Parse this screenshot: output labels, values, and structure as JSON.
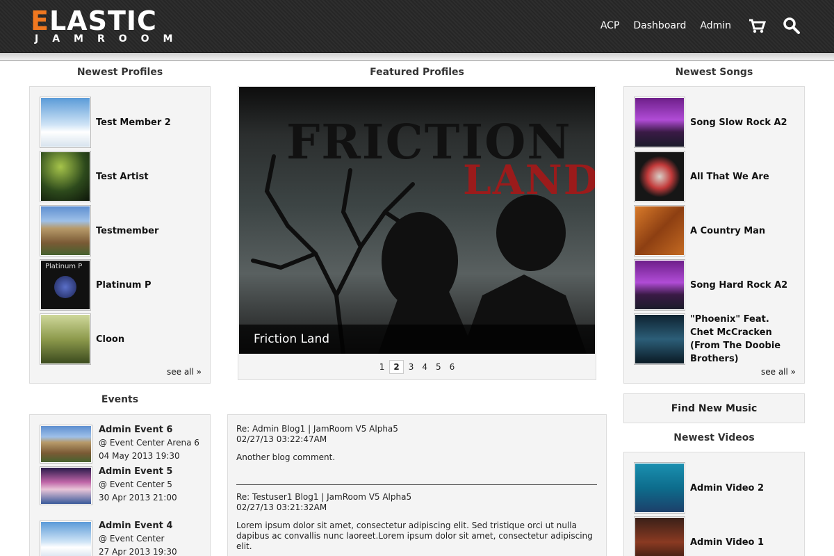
{
  "header": {
    "logo_main_accent": "E",
    "logo_main_rest": "LASTIC",
    "logo_sub": "JAMROOM",
    "nav": [
      "ACP",
      "Dashboard",
      "Admin"
    ],
    "icons": [
      "cart-icon",
      "search-icon"
    ]
  },
  "newest_profiles": {
    "title": "Newest Profiles",
    "items": [
      "Test Member 2",
      "Test Artist",
      "Testmember",
      "Platinum P",
      "Cloon"
    ],
    "see_all": "see all »",
    "platinum_thumb_text": "Platinum P"
  },
  "featured": {
    "title": "Featured Profiles",
    "image_text_1": "FRICTION",
    "image_text_2": "LAND",
    "caption": "Friction Land",
    "pages": [
      "1",
      "2",
      "3",
      "4",
      "5",
      "6"
    ],
    "active_page": "2"
  },
  "newest_songs": {
    "title": "Newest Songs",
    "items": [
      "Song Slow Rock A2",
      "All That We Are",
      "A Country Man",
      "Song Hard Rock A2",
      "\"Phoenix\" Feat. Chet McCracken (From The Doobie Brothers)"
    ],
    "see_all": "see all »"
  },
  "events": {
    "title": "Events",
    "items": [
      {
        "title": "Admin Event 6",
        "venue": "@ Event Center Arena 6",
        "date": "04 May 2013 19:30"
      },
      {
        "title": "Admin Event 5",
        "venue": "@ Event Center 5",
        "date": "30 Apr 2013 21:00"
      },
      {
        "title": "Admin Event 4",
        "venue": "@ Event Center",
        "date": "27 Apr 2013 19:30"
      }
    ]
  },
  "blog": {
    "entries": [
      {
        "title": "Re: Admin Blog1 | JamRoom V5 Alpha5",
        "date": "02/27/13 03:22:47AM",
        "body": "Another blog comment."
      },
      {
        "title": "Re: Testuser1 Blog1 | JamRoom V5 Alpha5",
        "date": "02/27/13 03:21:32AM",
        "body": "Lorem ipsum dolor sit amet, consectetur adipiscing elit. Sed tristique orci ut nulla dapibus ac convallis nunc laoreet.Lorem ipsum dolor sit amet, consectetur adipiscing elit."
      }
    ]
  },
  "find_music": "Find New Music",
  "newest_videos": {
    "title": "Newest Videos",
    "items": [
      "Admin Video 2",
      "Admin Video 1"
    ]
  },
  "colors": {
    "accent": "#f07820",
    "header_bg": "#2a2a2a",
    "panel_bg": "#f4f4f4"
  }
}
